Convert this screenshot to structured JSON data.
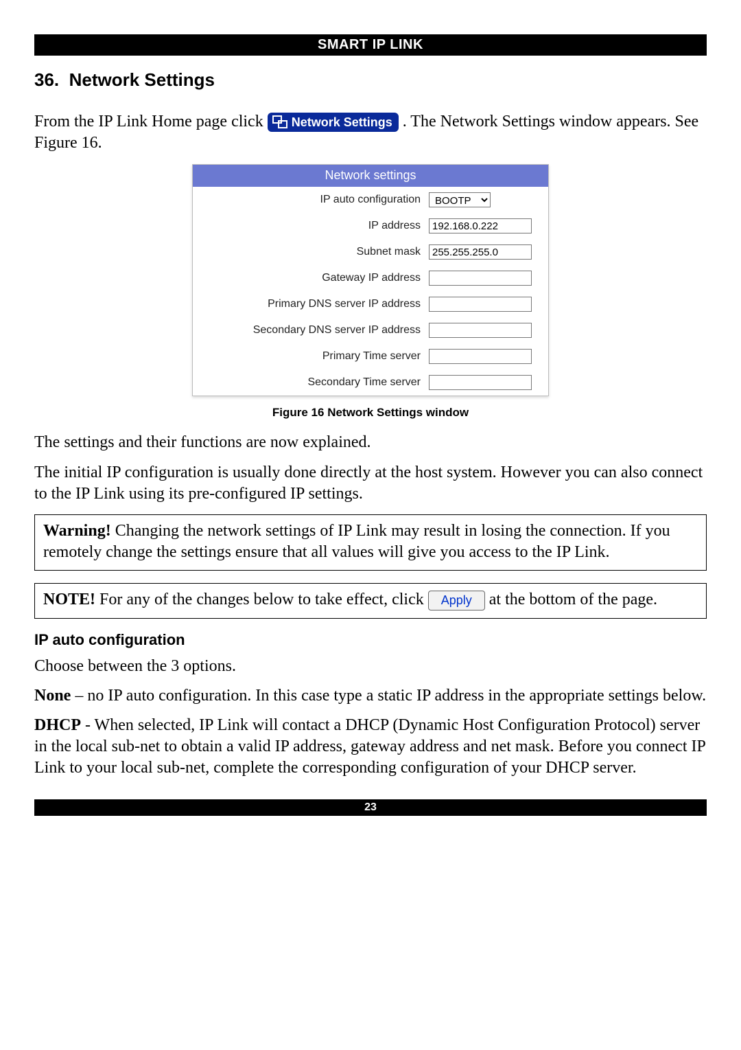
{
  "header_bar": "SMART IP LINK",
  "section": {
    "number": "36.",
    "title": "Network Settings"
  },
  "intro": {
    "p1_pre": "From the IP Link Home page click ",
    "btn_label": "Network Settings",
    "p1_post": ". The Network Settings window appears. See Figure 16."
  },
  "panel": {
    "title": "Network settings",
    "rows": {
      "ip_auto": {
        "label": "IP auto configuration",
        "selected": "BOOTP"
      },
      "ip_addr": {
        "label": "IP address",
        "value": "192.168.0.222"
      },
      "subnet": {
        "label": "Subnet mask",
        "value": "255.255.255.0"
      },
      "gateway": {
        "label": "Gateway IP address",
        "value": ""
      },
      "dns1": {
        "label": "Primary DNS server IP address",
        "value": ""
      },
      "dns2": {
        "label": "Secondary DNS server IP address",
        "value": ""
      },
      "time1": {
        "label": "Primary Time server",
        "value": ""
      },
      "time2": {
        "label": "Secondary Time server",
        "value": ""
      }
    }
  },
  "figure_caption": "Figure 16 Network Settings window",
  "p_explained": "The settings and their functions are now explained.",
  "p_initial": "The initial IP configuration is usually done directly at the host system. However you can also connect to the IP Link using its pre-configured IP settings.",
  "warning_box": {
    "label": "Warning!",
    "text": " Changing the network settings of IP Link may result in losing the connection. If you remotely change the settings ensure that all values will give you access to the IP Link."
  },
  "note_box": {
    "label": "NOTE!",
    "pre": " For any of the changes below to take effect, click ",
    "apply_label": "Apply",
    "post": " at the bottom of the page."
  },
  "sub_heading": "IP auto configuration",
  "p_choose": "Choose between the 3 options.",
  "opt_none": {
    "label": "None",
    "text": " – no IP auto configuration. In this case type a static IP address in the appropriate settings below."
  },
  "opt_dhcp": {
    "label": "DHCP",
    "text": " - When selected, IP Link will contact a DHCP (Dynamic Host Configuration Protocol) server in the local sub-net to obtain a valid IP address, gateway address and net mask. Before you connect IP Link to your local sub-net, complete the corresponding configuration of your DHCP server."
  },
  "footer_page": "23"
}
